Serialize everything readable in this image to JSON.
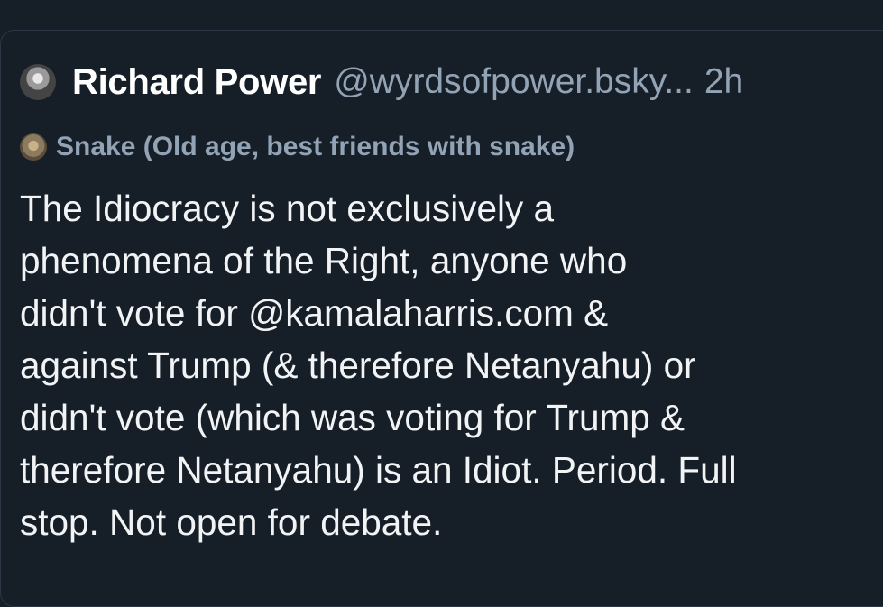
{
  "post": {
    "author_name": "Richard Power",
    "author_handle": "@wyrdsofpower.bsky...",
    "timestamp": "2h",
    "context_label": "Snake (Old age, best friends with snake)",
    "text": "The Idiocracy is not exclusively a\nphenomena of the Right, anyone who\ndidn't vote for @kamalaharris.com &\nagainst Trump (& therefore Netanyahu) or\ndidn't vote (which was voting for Trump &\ntherefore Netanyahu) is an Idiot. Period. Full\nstop. Not open for debate."
  },
  "colors": {
    "background": "#161e27",
    "text_primary": "#ffffff",
    "text_secondary": "#93a3b6",
    "border": "#2b3744"
  }
}
